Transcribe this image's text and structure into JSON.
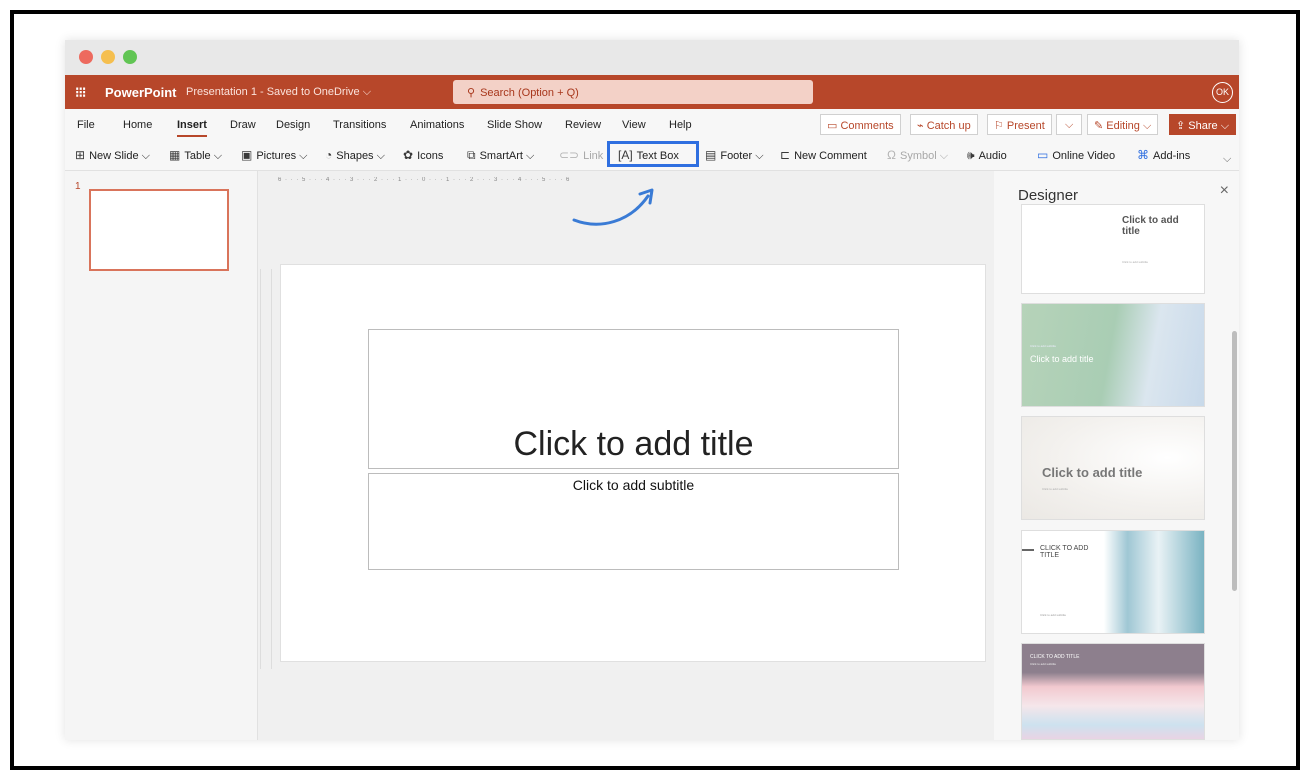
{
  "window": {
    "controls": [
      "close",
      "minimize",
      "maximize"
    ]
  },
  "appbar": {
    "app_name": "PowerPoint",
    "doc_title": "Presentation 1  -  Saved to OneDrive ⌵",
    "search_placeholder": "Search (Option + Q)",
    "avatar": "OK"
  },
  "menu": {
    "tabs": [
      "File",
      "Home",
      "Insert",
      "Draw",
      "Design",
      "Transitions",
      "Animations",
      "Slide Show",
      "Review",
      "View",
      "Help"
    ],
    "active": "Insert",
    "comments": "Comments",
    "catch_up": "Catch up",
    "present": "Present",
    "present_caret": "⌵",
    "editing": "Editing ⌵",
    "share": "Share ⌵"
  },
  "ribbon": {
    "new_slide": "New Slide ⌵",
    "table": "Table ⌵",
    "pictures": "Pictures ⌵",
    "shapes": "Shapes ⌵",
    "icons": "Icons",
    "smartart": "SmartArt ⌵",
    "link": "Link",
    "text_box": "Text Box",
    "footer": "Footer ⌵",
    "new_comment": "New Comment",
    "symbol": "Symbol ⌵",
    "audio": "Audio",
    "online_video": "Online Video",
    "add_ins": "Add-ins"
  },
  "thumbnails": {
    "slide_number": "1"
  },
  "ruler": {
    "horizontal": "6 · · · 5 · · · 4 · · · 3 · · · 2 · · · 1 · · · 0 · · · 1 · · · 2 · · · 3 · · · 4 · · · 5 · · · 6"
  },
  "slide": {
    "title_placeholder": "Click to add title",
    "subtitle_placeholder": "Click to add subtitle"
  },
  "designer": {
    "header": "Designer",
    "close": "×",
    "cards": [
      {
        "title": "Click to add title",
        "subtitle": "Click to add subtitle"
      },
      {
        "title": "Click to add title",
        "subtitle": "Click to add subtitle"
      },
      {
        "title": "Click to add title",
        "subtitle": "Click to add subtitle"
      },
      {
        "title": "CLICK TO ADD TITLE",
        "subtitle": "Click to add subtitle"
      },
      {
        "title": "CLICK TO ADD TITLE",
        "subtitle": "Click to add subtitle"
      }
    ]
  },
  "colors": {
    "brand": "#b7472a",
    "highlight": "#2f6fe0",
    "arrow": "#3a7bd5"
  }
}
